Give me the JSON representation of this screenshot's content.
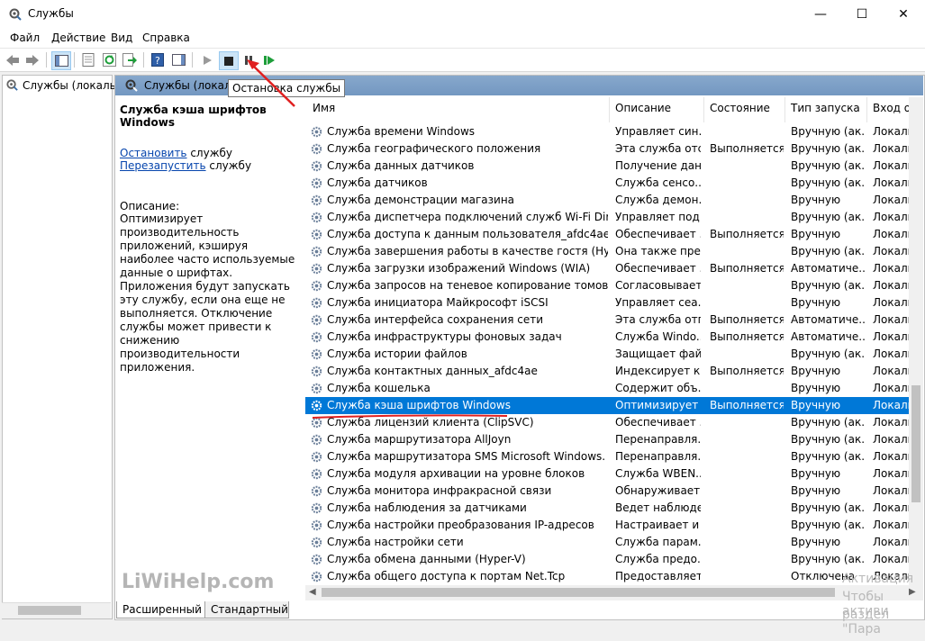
{
  "window": {
    "title": "Службы",
    "minimize": "—",
    "maximize": "☐",
    "close": "✕"
  },
  "menu": [
    "Файл",
    "Действие",
    "Вид",
    "Справка"
  ],
  "tree": {
    "root_label": "Службы (локалы"
  },
  "pane": {
    "title": "Службы (локал"
  },
  "tooltip": "Остановка службы",
  "description": {
    "title": "Служба кэша шрифтов Windows",
    "stop_link": "Остановить",
    "stop_suffix": " службу",
    "restart_link": "Перезапустить",
    "restart_suffix": " службу",
    "label": "Описание:",
    "text": "Оптимизирует производительность приложений, кэшируя наиболее часто используемые данные о шрифтах. Приложения будут запускать эту службу, если она еще не выполняется. Отключение службы может привести к снижению производительности приложения."
  },
  "columns": [
    "Имя",
    "Описание",
    "Состояние",
    "Тип запуска",
    "Вход от"
  ],
  "rows": [
    {
      "name": "Служба времени Windows",
      "desc": "Управляет син...",
      "state": "",
      "start": "Вручную (ак...",
      "logon": "Локаль"
    },
    {
      "name": "Служба географического положения",
      "desc": "Эта служба отс...",
      "state": "Выполняется",
      "start": "Вручную (ак...",
      "logon": "Локаль"
    },
    {
      "name": "Служба данных датчиков",
      "desc": "Получение дан...",
      "state": "",
      "start": "Вручную (ак...",
      "logon": "Локаль"
    },
    {
      "name": "Служба датчиков",
      "desc": "Служба сенсо...",
      "state": "",
      "start": "Вручную (ак...",
      "logon": "Локаль"
    },
    {
      "name": "Служба демонстрации магазина",
      "desc": "Служба демон...",
      "state": "",
      "start": "Вручную",
      "logon": "Локаль"
    },
    {
      "name": "Служба диспетчера подключений служб Wi-Fi Direct",
      "desc": "Управляет под...",
      "state": "",
      "start": "Вручную (ак...",
      "logon": "Локаль"
    },
    {
      "name": "Служба доступа к данным пользователя_afdc4ae",
      "desc": "Обеспечивает ...",
      "state": "Выполняется",
      "start": "Вручную",
      "logon": "Локаль"
    },
    {
      "name": "Служба завершения работы в качестве гостя (Hyper-V)",
      "desc": "Она также пре...",
      "state": "",
      "start": "Вручную (ак...",
      "logon": "Локаль"
    },
    {
      "name": "Служба загрузки изображений Windows (WIA)",
      "desc": "Обеспечивает ...",
      "state": "Выполняется",
      "start": "Автоматиче...",
      "logon": "Локаль"
    },
    {
      "name": "Служба запросов на теневое копирование томов Hype...",
      "desc": "Согласовывает...",
      "state": "",
      "start": "Вручную (ак...",
      "logon": "Локаль"
    },
    {
      "name": "Служба инициатора Майкрософт iSCSI",
      "desc": "Управляет сеа...",
      "state": "",
      "start": "Вручную",
      "logon": "Локаль"
    },
    {
      "name": "Служба интерфейса сохранения сети",
      "desc": "Эта служба отп...",
      "state": "Выполняется",
      "start": "Автоматиче...",
      "logon": "Локаль"
    },
    {
      "name": "Служба инфраструктуры фоновых задач",
      "desc": "Служба Windo...",
      "state": "Выполняется",
      "start": "Автоматиче...",
      "logon": "Локаль"
    },
    {
      "name": "Служба истории файлов",
      "desc": "Защищает фай...",
      "state": "",
      "start": "Вручную (ак...",
      "logon": "Локаль"
    },
    {
      "name": "Служба контактных данных_afdc4ae",
      "desc": "Индексирует к...",
      "state": "Выполняется",
      "start": "Вручную",
      "logon": "Локаль"
    },
    {
      "name": "Служба кошелька",
      "desc": "Содержит объ...",
      "state": "",
      "start": "Вручную",
      "logon": "Локаль"
    },
    {
      "name": "Служба кэша шрифтов Windows",
      "desc": "Оптимизирует ...",
      "state": "Выполняется",
      "start": "Вручную",
      "logon": "Локаль",
      "selected": true
    },
    {
      "name": "Служба лицензий клиента (ClipSVC)",
      "desc": "Обеспечивает ...",
      "state": "",
      "start": "Вручную (ак...",
      "logon": "Локаль"
    },
    {
      "name": "Служба маршрутизатора AllJoyn",
      "desc": "Перенаправля...",
      "state": "",
      "start": "Вручную (ак...",
      "logon": "Локаль"
    },
    {
      "name": "Служба маршрутизатора SMS Microsoft Windows.",
      "desc": "Перенаправля...",
      "state": "",
      "start": "Вручную (ак...",
      "logon": "Локаль"
    },
    {
      "name": "Служба модуля архивации на уровне блоков",
      "desc": "Служба WBEN...",
      "state": "",
      "start": "Вручную",
      "logon": "Локаль"
    },
    {
      "name": "Служба монитора инфракрасной связи",
      "desc": "Обнаруживает ...",
      "state": "",
      "start": "Вручную",
      "logon": "Локаль"
    },
    {
      "name": "Служба наблюдения за датчиками",
      "desc": "Ведет наблюде...",
      "state": "",
      "start": "Вручную (ак...",
      "logon": "Локаль"
    },
    {
      "name": "Служба настройки преобразования IP-адресов",
      "desc": "Настраивает и ...",
      "state": "",
      "start": "Вручную (ак...",
      "logon": "Локаль"
    },
    {
      "name": "Служба настройки сети",
      "desc": "Служба парам...",
      "state": "",
      "start": "Вручную",
      "logon": "Локаль"
    },
    {
      "name": "Служба обмена данными (Hyper-V)",
      "desc": "Служба предо...",
      "state": "",
      "start": "Вручную (ак...",
      "logon": "Локаль"
    },
    {
      "name": "Служба общего доступа к портам Net.Tcp",
      "desc": "Предоставляет...",
      "state": "",
      "start": "Отключена",
      "logon": "Локаль"
    }
  ],
  "tabs": [
    "Расширенный",
    "Стандартный"
  ],
  "watermark": "LiWiHelp.com",
  "activation": [
    "Активация",
    "Чтобы активи",
    "раздел \"Пара"
  ],
  "colors": {
    "selection": "#0078d7",
    "header": "#7a9cc6",
    "link": "#0645ad",
    "annotation": "#e02020"
  }
}
